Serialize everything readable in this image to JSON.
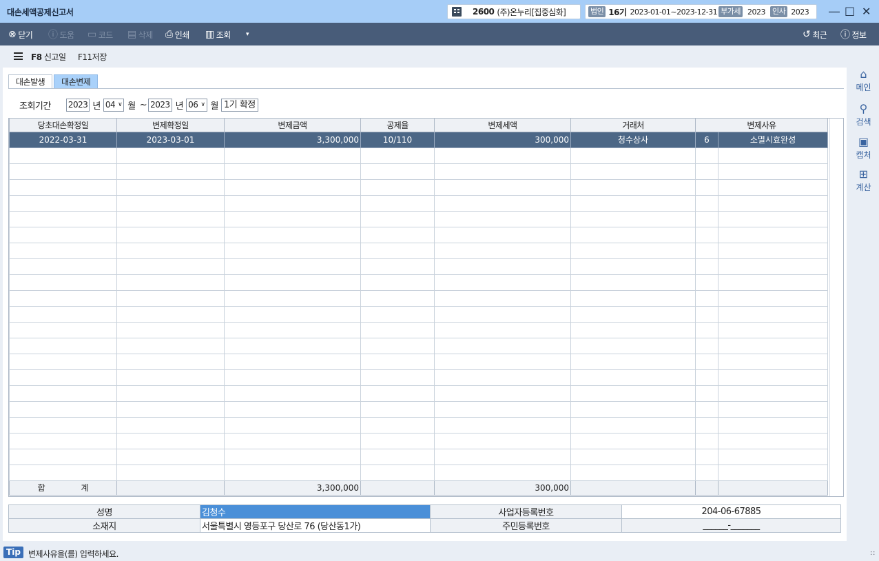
{
  "window": {
    "title": "대손세액공제신고서",
    "company_code": "2600",
    "company_name": "(주)온누리[집중심화]",
    "corp_tag": "법인",
    "fiscal_term": "16기",
    "fiscal_period": "2023-01-01~2023-12-31",
    "vat_tag": "부가세",
    "vat_year": "2023",
    "hr_tag": "인사",
    "hr_year": "2023"
  },
  "toolbar": {
    "close": "닫기",
    "help": "도움",
    "code": "코드",
    "delete": "삭제",
    "print": "인쇄",
    "lookup": "조회",
    "recent": "최근",
    "info": "정보"
  },
  "subbar": {
    "f8_key": "F8",
    "f8_label": "신고일",
    "f11_key": "F11",
    "f11_label": "저장"
  },
  "tabs": [
    {
      "label": "대손발생",
      "active": false
    },
    {
      "label": "대손변제",
      "active": true
    }
  ],
  "filter": {
    "label": "조회기간",
    "from_year": "2023",
    "year_unit": "년",
    "from_month": "04",
    "month_unit": "월",
    "tilde": "~",
    "to_year": "2023",
    "to_month": "06",
    "period_button": "1기 확정"
  },
  "grid": {
    "columns": [
      "당초대손확정일",
      "변제확정일",
      "변제금액",
      "공제율",
      "변제세액",
      "거래처",
      "변제사유"
    ],
    "rows": [
      {
        "orig_date": "2022-03-31",
        "repay_date": "2023-03-01",
        "amount": "3,300,000",
        "rate": "10/110",
        "tax": "300,000",
        "partner": "청수상사",
        "reason_code": "6",
        "reason": "소멸시효완성"
      }
    ],
    "total": {
      "label_1": "합",
      "label_2": "계",
      "amount": "3,300,000",
      "tax": "300,000"
    }
  },
  "info": {
    "name_label": "성명",
    "name_value": "김청수",
    "biz_no_label": "사업자등록번호",
    "biz_no_value": "204-06-67885",
    "address_label": "소재지",
    "address_value": "서울특별시 영등포구 당산로 76 (당산동1가)",
    "resident_no_label": "주민등록번호",
    "resident_no_value": "______-_______"
  },
  "rail": {
    "main": "메인",
    "search": "검색",
    "capture": "캡처",
    "calc": "계산"
  },
  "status": {
    "tip_badge": "Tip",
    "tip_text": "변제사유을(를) 입력하세요."
  }
}
